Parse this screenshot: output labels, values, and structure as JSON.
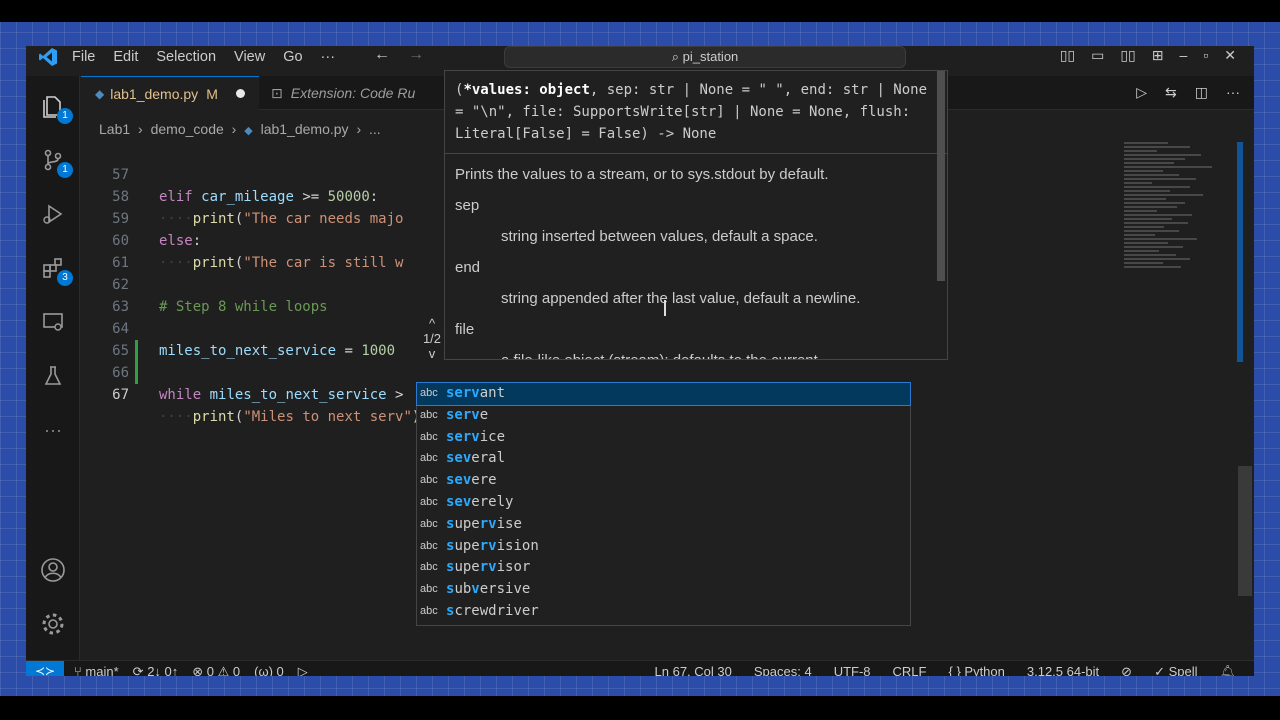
{
  "menu": [
    "File",
    "Edit",
    "Selection",
    "View",
    "Go",
    "···"
  ],
  "search": "pi_station",
  "tabs": {
    "active_name": "lab1_demo.py",
    "active_status": "M",
    "second": "Extension: Code Ru"
  },
  "breadcrumb": [
    "Lab1",
    "›",
    "demo_code",
    "›",
    "lab1_demo.py",
    "›",
    "..."
  ],
  "activity_badges": {
    "explorer": "1",
    "scm": "1",
    "extensions": "3"
  },
  "code": {
    "l57": {
      "n": "57",
      "kw": "elif",
      "v": "car_mileage",
      "op": ">=",
      "num": "50000",
      "tail": ":"
    },
    "l58": {
      "n": "58",
      "fn": "print",
      "str": "\"The car needs majo"
    },
    "l59": {
      "n": "59",
      "kw": "else",
      "tail": ":"
    },
    "l60": {
      "n": "60",
      "fn": "print",
      "str": "\"The car is still w"
    },
    "l61": {
      "n": "61"
    },
    "l62": {
      "n": "62",
      "cm": "# Step 8 while loops"
    },
    "l63": {
      "n": "63"
    },
    "l64": {
      "n": "64",
      "v": "miles_to_next_service",
      "op": "=",
      "num": "1000"
    },
    "l65": {
      "n": "65"
    },
    "l66": {
      "n": "66",
      "kw": "while",
      "v": "miles_to_next_service",
      "op": ">"
    },
    "l67": {
      "n": "67",
      "fn": "print",
      "str": "\"Miles to next serv\"",
      "close": ")"
    }
  },
  "hover": {
    "signature_param": "*values: object",
    "signature_rest": ", sep: str | None = \" \", end: str | None = \"\\n\", file: SupportsWrite[str] | None = None, flush: Literal[False] = False) -> None",
    "summary": "Prints the values to a stream, or to sys.stdout by default.",
    "sep": "sep",
    "sep_desc": "string inserted between values, default a space.",
    "end": "end",
    "end_desc": "string appended after the last value, default a newline.",
    "file": "file",
    "file_desc": "a file-like object (stream); defaults to the current",
    "overload_up": "^",
    "overload": "1/2",
    "overload_down": "v"
  },
  "suggestions": [
    {
      "kind": "abc",
      "a": "serv",
      "b": "ant",
      "matched_prefix": "serv"
    },
    {
      "kind": "abc",
      "a": "serv",
      "b": "e"
    },
    {
      "kind": "abc",
      "a": "serv",
      "b": "ice"
    },
    {
      "kind": "abc",
      "a": "se",
      "b": "",
      "c": "v",
      "d": "eral"
    },
    {
      "kind": "abc",
      "a": "se",
      "b": "",
      "c": "v",
      "d": "ere"
    },
    {
      "kind": "abc",
      "a": "se",
      "b": "",
      "c": "v",
      "d": "erely"
    },
    {
      "kind": "abc",
      "a": "s",
      "b": "upe",
      "c": "r",
      "d": "v",
      "e": "ise"
    },
    {
      "kind": "abc",
      "a": "s",
      "b": "upe",
      "c": "r",
      "d": "v",
      "e": "ision"
    },
    {
      "kind": "abc",
      "a": "s",
      "b": "upe",
      "c": "r",
      "d": "v",
      "e": "isor"
    },
    {
      "kind": "abc",
      "a": "s",
      "b": "ub",
      "c": "v",
      "d": "ersive"
    },
    {
      "kind": "abc",
      "a": "s",
      "b": "",
      "c": "crew",
      "d": "driver"
    }
  ],
  "status": {
    "branch": "main*",
    "sync": "2↓ 0↑",
    "problems": "⊗ 0 ⚠ 0",
    "ports": "(ω) 0",
    "position": "Ln 67, Col 30",
    "spaces": "Spaces: 4",
    "encoding": "UTF-8",
    "eol": "CRLF",
    "language": "{ } Python",
    "interpreter": "3.12.5 64-bit",
    "spell": "✓ Spell"
  },
  "colors": {
    "accent": "#0078d4",
    "frame": "#2b4ca8",
    "suggest_match": "#2aaaff"
  }
}
